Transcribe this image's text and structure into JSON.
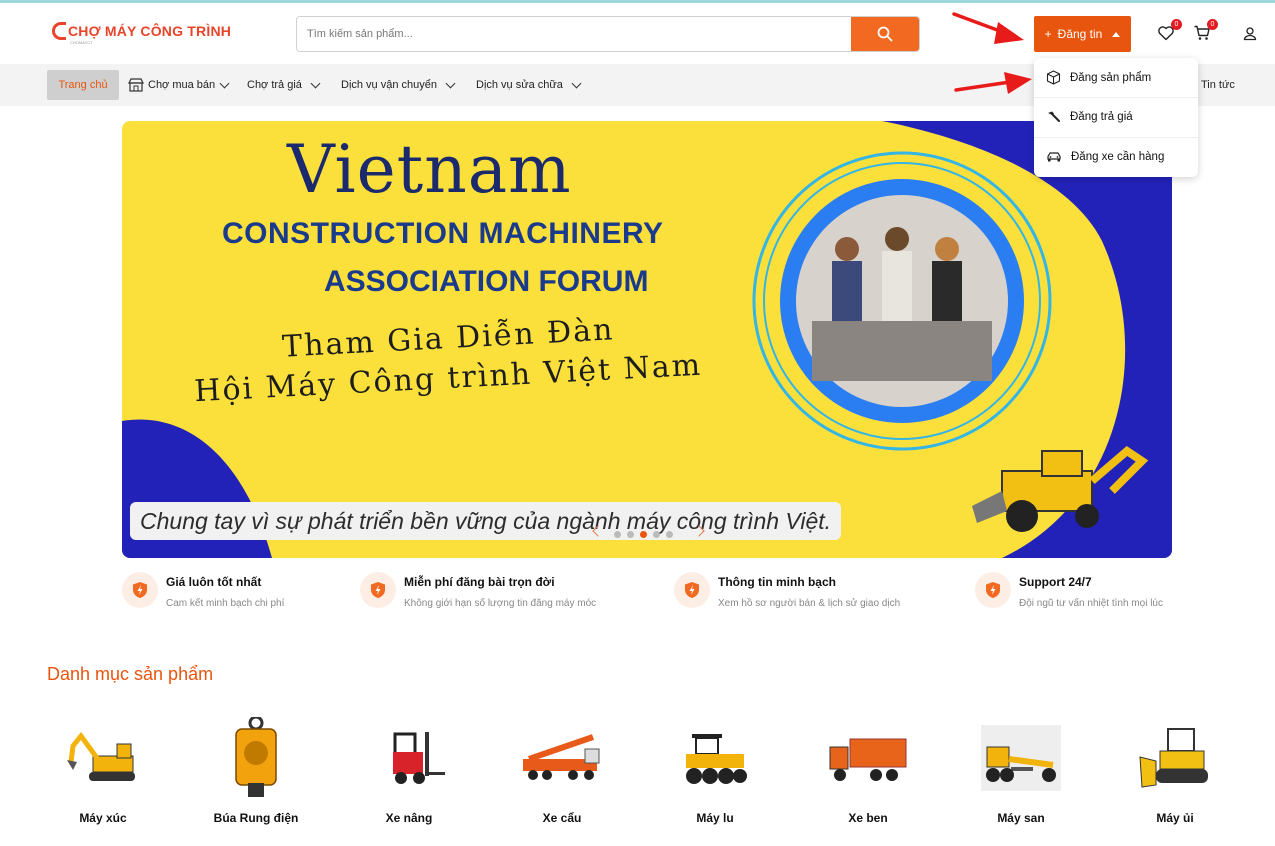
{
  "header": {
    "logo_text": "CHỢ MÁY CÔNG TRÌNH",
    "logo_sub": "CHOMAYCT",
    "search_placeholder": "Tìm kiếm sản phẩm...",
    "post_button_label": "Đăng tin",
    "wishlist_count": "0",
    "cart_count": "0"
  },
  "nav": {
    "home": "Trang chủ",
    "items": [
      "Chợ mua bán",
      "Chợ trả giá",
      "Dịch vụ vận chuyển",
      "Dịch vụ sửa chữa"
    ],
    "right_item": "Tin tức"
  },
  "dropdown": {
    "items": [
      {
        "label": "Đăng sản phẩm",
        "icon": "box-icon"
      },
      {
        "label": "Đăng trả giá",
        "icon": "hammer-icon"
      },
      {
        "label": "Đăng xe cần hàng",
        "icon": "car-icon"
      }
    ]
  },
  "banner": {
    "title1": "Vietnam",
    "title2": "CONSTRUCTION MACHINERY",
    "title3": "ASSOCIATION FORUM",
    "line1": "Tham Gia Diễn Đàn",
    "line2": "Hội Máy Công trình Việt Nam",
    "slogan": "Chung tay vì sự phát triển bền vững của ngành máy công trình Việt.",
    "slides": 5,
    "active_slide": 3
  },
  "features": [
    {
      "title": "Giá luôn tốt nhất",
      "subtitle": "Cam kết minh bạch chi phí"
    },
    {
      "title": "Miễn phí đăng bài trọn đời",
      "subtitle": "Không giới hạn số lượng tin đăng máy móc"
    },
    {
      "title": "Thông tin minh bạch",
      "subtitle": "Xem hồ sơ người bán & lịch sử giao dịch"
    },
    {
      "title": "Support 24/7",
      "subtitle": "Đội ngũ tư vấn nhiệt tình mọi lúc"
    }
  ],
  "categories": {
    "title": "Danh mục sản phẩm",
    "items": [
      "Máy xúc",
      "Búa Rung điện",
      "Xe nâng",
      "Xe cẩu",
      "Máy lu",
      "Xe ben",
      "Máy san",
      "Máy ủi"
    ]
  },
  "colors": {
    "accent": "#e8550f",
    "brand": "#e8442a",
    "banner_bg": "#fbe03b",
    "banner_blue": "#1a2a9c"
  }
}
